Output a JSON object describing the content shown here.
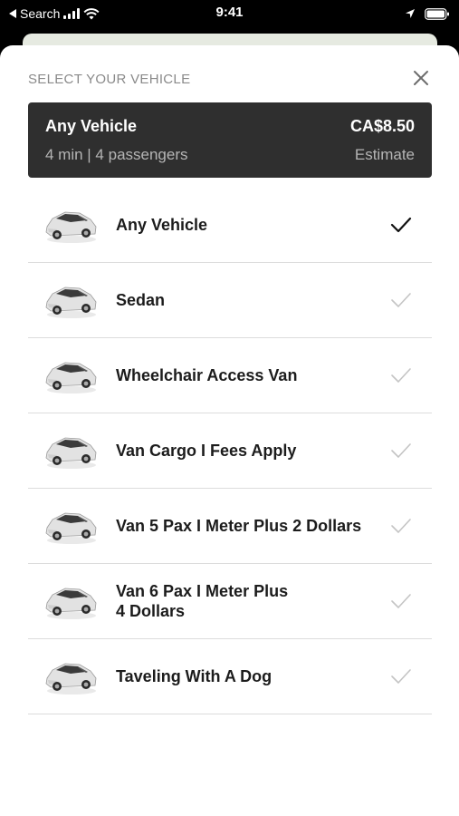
{
  "status_bar": {
    "back_label": "Search",
    "time": "9:41"
  },
  "sheet": {
    "header": "SELECT YOUR VEHICLE",
    "summary": {
      "title": "Any Vehicle",
      "price": "CA$8.50",
      "subtitle": "4 min | 4 passengers",
      "estimate_label": "Estimate"
    },
    "vehicles": [
      {
        "label": "Any Vehicle",
        "selected": true
      },
      {
        "label": "Sedan",
        "selected": false
      },
      {
        "label": "Wheelchair Access Van",
        "selected": false
      },
      {
        "label": "Van Cargo  I  Fees Apply",
        "selected": false
      },
      {
        "label": "Van 5 Pax I Meter Plus 2 Dollars",
        "selected": false
      },
      {
        "label": "Van 6 Pax  I  Meter Plus\n4 Dollars",
        "selected": false
      },
      {
        "label": "Taveling With A Dog",
        "selected": false
      }
    ]
  },
  "icons": {
    "vehicle": "car-icon",
    "selected": "checkmark-icon",
    "close": "close-icon"
  },
  "colors": {
    "summary_bg": "#2f2f2f",
    "check_selected": "#111111",
    "check_unselected": "#c4c4c4"
  }
}
